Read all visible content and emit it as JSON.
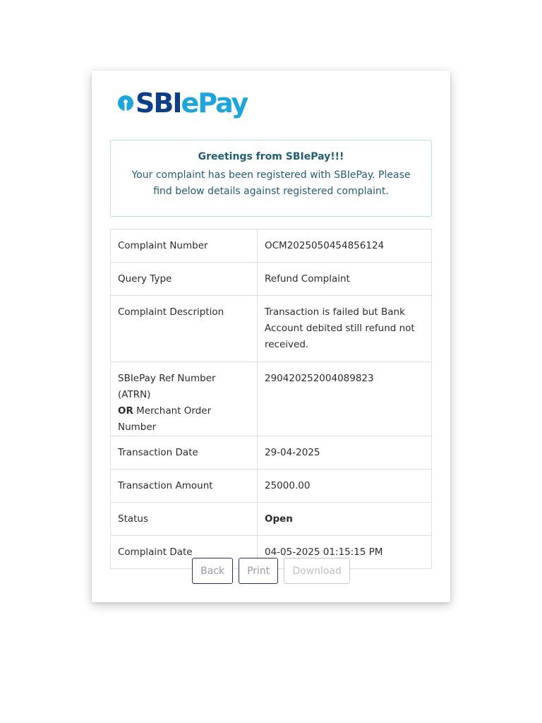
{
  "logo": {
    "text_dark": "SBI",
    "text_light": "ePay"
  },
  "greeting": {
    "title": "Greetings from SBIePay!!!",
    "body": "Your complaint has been registered with SBIePay. Please find below details against registered complaint."
  },
  "details": {
    "complaint_number": {
      "label": "Complaint Number",
      "value": "OCM2025050454856124"
    },
    "query_type": {
      "label": "Query Type",
      "value": "Refund Complaint"
    },
    "complaint_description": {
      "label": "Complaint Description",
      "value": "Transaction is failed but Bank Account debited still refund not received."
    },
    "ref_number": {
      "label_line1": "SBIePay Ref Number (ATRN)",
      "label_or": "OR",
      "label_line2": "Merchant Order Number",
      "value": "290420252004089823"
    },
    "transaction_date": {
      "label": "Transaction Date",
      "value": "29-04-2025"
    },
    "transaction_amount": {
      "label": "Transaction Amount",
      "value": "25000.00"
    },
    "status": {
      "label": "Status",
      "value": "Open"
    },
    "complaint_date": {
      "label": "Complaint Date",
      "value": "04-05-2025 01:15:15 PM"
    }
  },
  "buttons": {
    "back": "Back",
    "print": "Print",
    "download": "Download"
  },
  "colors": {
    "brand_dark": "#0b3f8c",
    "brand_light": "#1aa7e0",
    "greeting_text": "#1e5f73",
    "button_border": "#2e2a7a"
  }
}
